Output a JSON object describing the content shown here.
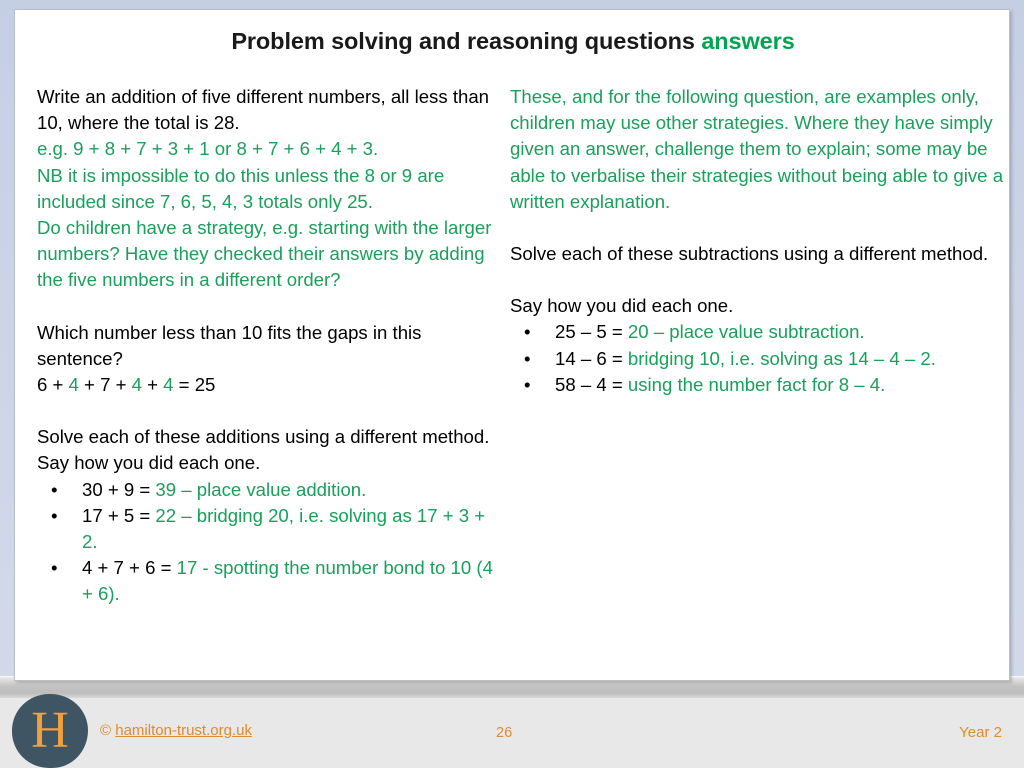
{
  "slide": {
    "title_main": "Problem solving and reasoning questions ",
    "title_highlight": "answers",
    "left_column": {
      "q1_black_line1": "Write an addition of five different numbers, all less than 10, where the total is 28.",
      "q1_green_line1": "e.g. 9 + 8 + 7 + 3 + 1 or 8 + 7 + 6 + 4 + 3.",
      "q1_green_line2": "NB it is impossible to do this unless the 8 or 9 are included since 7, 6, 5, 4, 3 totals only 25.",
      "q1_green_line3": "Do children have a strategy, e.g. starting with the larger numbers?  Have they checked their answers by adding the five numbers in a different order?",
      "q2_black": "Which number less than 10 fits the gaps in this sentence?",
      "q2_eq_part1": "6 + ",
      "q2_eq_gap1": "4",
      "q2_eq_part2": " + 7 + ",
      "q2_eq_gap2": "4",
      "q2_eq_part3": " + ",
      "q2_eq_gap3": "4",
      "q2_eq_part4": " = 25",
      "q3_black": "Solve each of these additions using a different method. Say how you did each one.",
      "bullets": [
        {
          "black": "30 + 9 = ",
          "green": "39 – place value addition."
        },
        {
          "black": "17 + 5 = ",
          "green": "22 – bridging 20, i.e. solving as 17 + 3 + 2."
        },
        {
          "black": "4 + 7 + 6 = ",
          "green": "17  - spotting the number bond to 10 (4 + 6)."
        }
      ]
    },
    "right_column": {
      "note_green": "These, and for the following question, are examples only, children may use other strategies. Where they have simply given an answer, challenge them to explain; some may be able to verbalise their strategies without being able to give a written explanation.",
      "q_black_1": "Solve each of these subtractions using a different method.",
      "q_black_2": "Say how you did each one.",
      "bullets": [
        {
          "black": "25 – 5  = ",
          "green": "20 – place value subtraction."
        },
        {
          "black": "14 – 6  = ",
          "green": "bridging 10, i.e. solving as 14 – 4 – 2."
        },
        {
          "black": "58 – 4  = ",
          "green": "using the number fact for 8 – 4."
        }
      ]
    }
  },
  "footer": {
    "logo_letter": "H",
    "copyright_symbol": "©",
    "link_text": "hamilton-trust.org.uk",
    "page_number": "26",
    "year_label": "Year 2"
  },
  "bullet_glyph": "•",
  "colors": {
    "answer_green": "#19a05a",
    "title_green": "#00a550",
    "footer_orange": "#e08a2e",
    "logo_slate": "#3f5563",
    "logo_orange": "#f2a03d"
  }
}
